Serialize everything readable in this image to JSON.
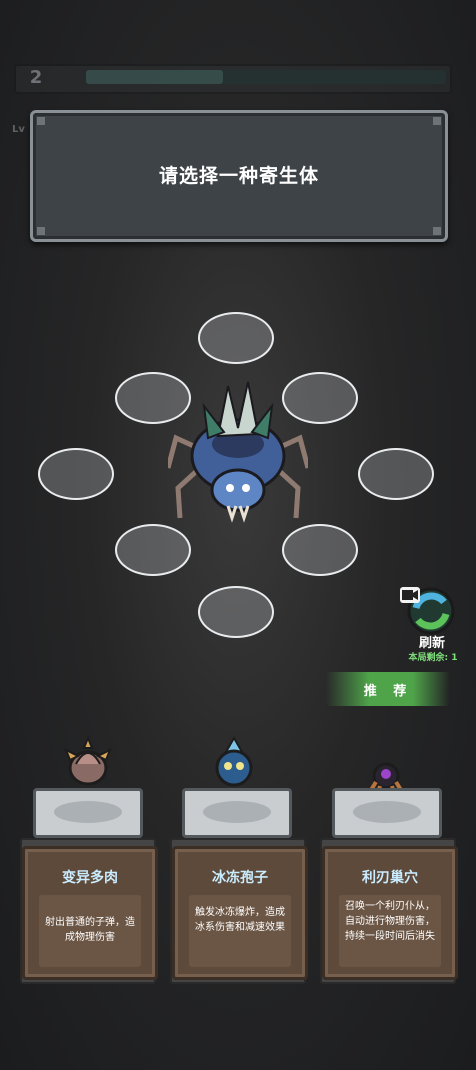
{
  "hud": {
    "level": "2",
    "level_prefix": "Lv",
    "progress": 0.38
  },
  "title_panel": {
    "text": "请选择一种寄生体"
  },
  "refresh": {
    "label": "刷新",
    "remaining": "本局剩余: 1"
  },
  "recommend": {
    "label": "推 荐"
  },
  "cards": [
    {
      "name": "变异多肉",
      "description": "射出普通的子弹，造成物理伤害",
      "icon": "mutant-succulent-icon"
    },
    {
      "name": "冰冻孢子",
      "description": "触发冰冻爆炸，造成冰系伤害和减速效果",
      "icon": "frost-spore-icon"
    },
    {
      "name": "利刃巢穴",
      "description": "召唤一个利刃仆从，自动进行物理伤害，持续一段时间后消失",
      "icon": "blade-nest-icon"
    }
  ],
  "colors": {
    "panel_bg": "#3e4347",
    "card_bg": "#5e4a3a",
    "card_title": "#c9ecff",
    "recommend_green": "#4fa44a",
    "remaining_green": "#7fe07b"
  }
}
